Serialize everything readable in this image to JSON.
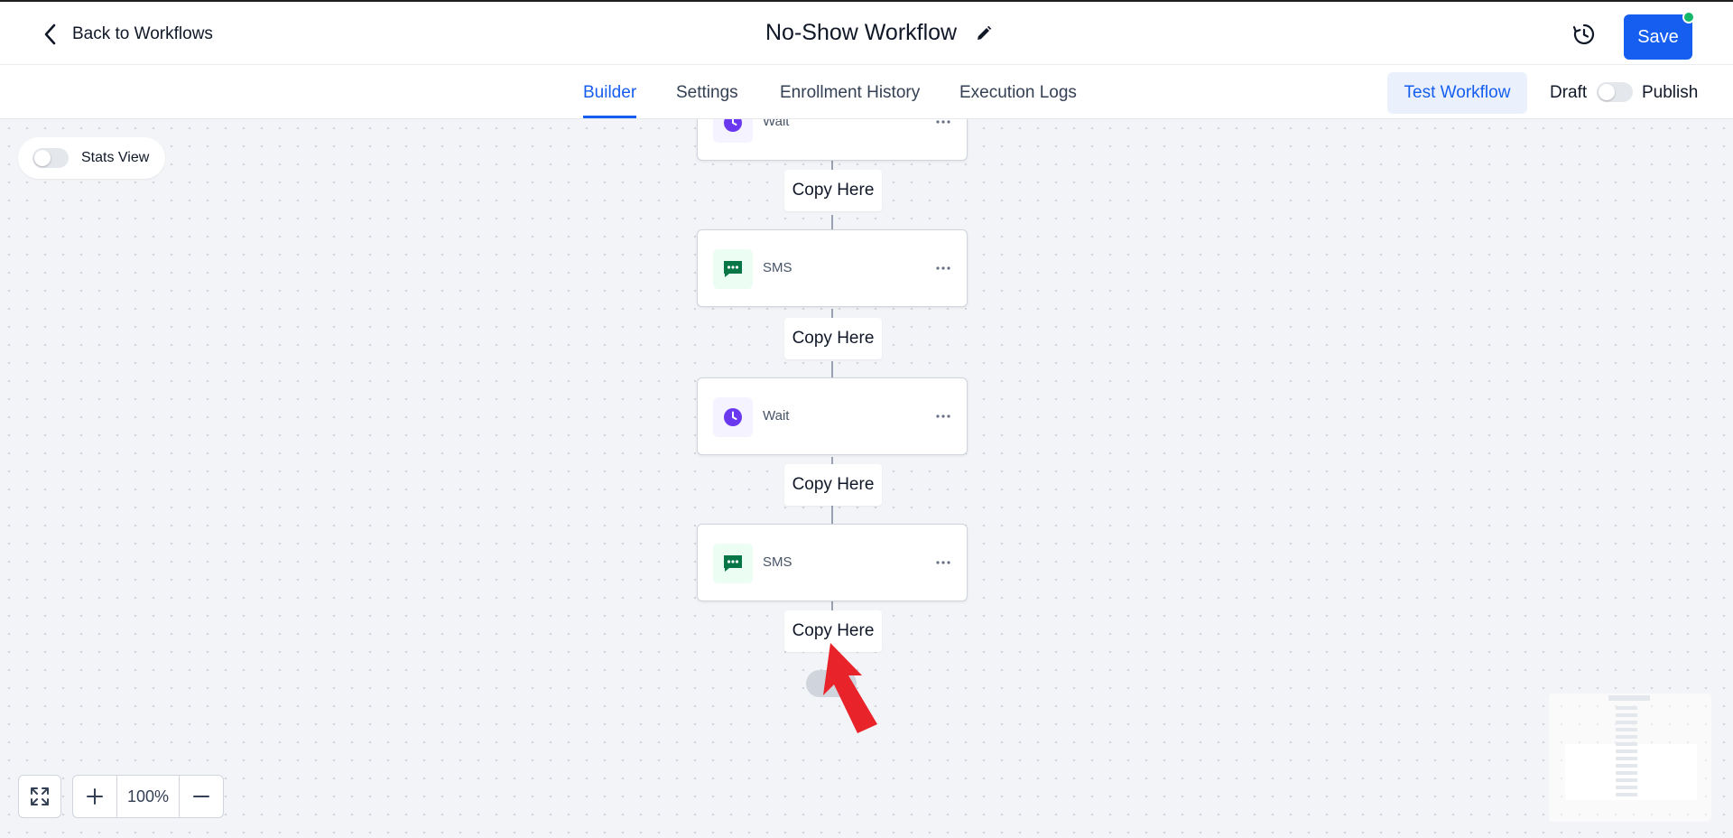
{
  "header": {
    "back_label": "Back to Workflows",
    "title": "No-Show Workflow",
    "save_label": "Save"
  },
  "tabs": [
    {
      "label": "Builder",
      "active": true
    },
    {
      "label": "Settings",
      "active": false
    },
    {
      "label": "Enrollment History",
      "active": false
    },
    {
      "label": "Execution Logs",
      "active": false
    }
  ],
  "toolbar": {
    "test_label": "Test Workflow",
    "draft_label": "Draft",
    "publish_label": "Publish",
    "publish_enabled": false
  },
  "canvas": {
    "stats_label": "Stats View",
    "stats_enabled": false,
    "copy_label": "Copy Here",
    "nodes": [
      {
        "type": "wait",
        "label": "Wait",
        "icon": "clock-icon"
      },
      {
        "type": "sms",
        "label": "SMS",
        "icon": "chat-icon"
      },
      {
        "type": "wait",
        "label": "Wait",
        "icon": "clock-icon"
      },
      {
        "type": "sms",
        "label": "SMS",
        "icon": "chat-icon"
      }
    ],
    "zoom_level": "100%"
  },
  "colors": {
    "accent": "#155eef",
    "wait_icon": "#6938ef",
    "sms_icon": "#067647",
    "status_dot": "#12b76a",
    "pointer": "#e8232a"
  }
}
